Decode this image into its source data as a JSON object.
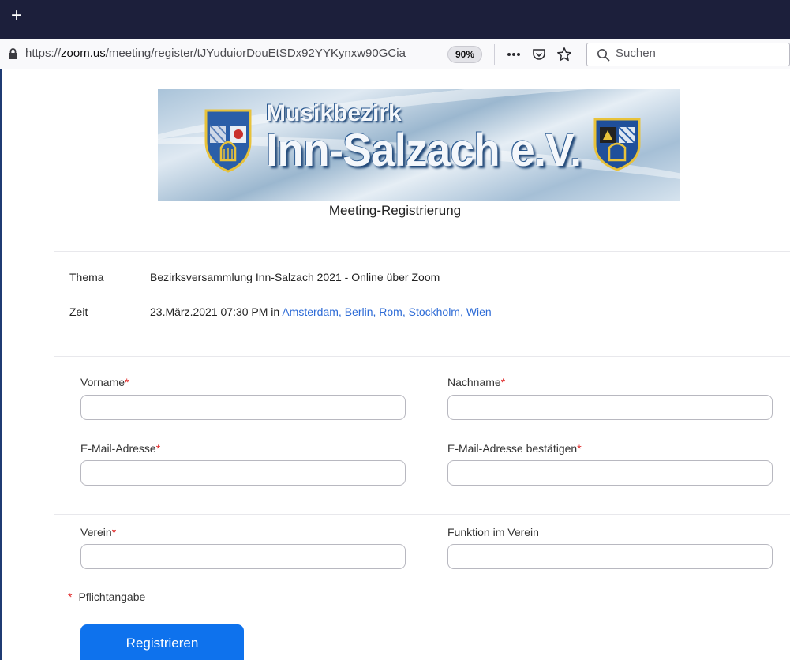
{
  "browser": {
    "new_tab_symbol": "+",
    "url_prefix": "https://",
    "url_host": "zoom.us",
    "url_path": "/meeting/register/tJYuduiorDouEtSDx92YYKynxw90GCia",
    "zoom_level": "90%",
    "more_icon": "ellipsis-icon",
    "pocket_icon": "pocket-icon",
    "bookmark_icon": "star-icon",
    "search_placeholder": "Suchen",
    "colors": {
      "tabbar": "#1c1f3b",
      "frame": "#1f3b73"
    }
  },
  "banner": {
    "line1": "Musikbezirk",
    "line2": "Inn-Salzach e.V."
  },
  "page": {
    "heading": "Meeting-Registrierung"
  },
  "meeting": {
    "topic_label": "Thema",
    "topic_value": "Bezirksversammlung Inn-Salzach 2021 - Online über Zoom",
    "time_label": "Zeit",
    "time_value": "23.März.2021 07:30 PM in",
    "timezone_link": "Amsterdam, Berlin, Rom, Stockholm, Wien"
  },
  "form": {
    "first_name_label": "Vorname",
    "last_name_label": "Nachname",
    "email_label": "E-Mail-Adresse",
    "email_confirm_label": "E-Mail-Adresse bestätigen",
    "club_label": "Verein",
    "role_label": "Funktion im Verein",
    "required_marker": "*",
    "required_note": "Pflichtangabe",
    "submit_label": "Registrieren",
    "accent_color": "#0e72ed",
    "required_color": "#e02828"
  }
}
